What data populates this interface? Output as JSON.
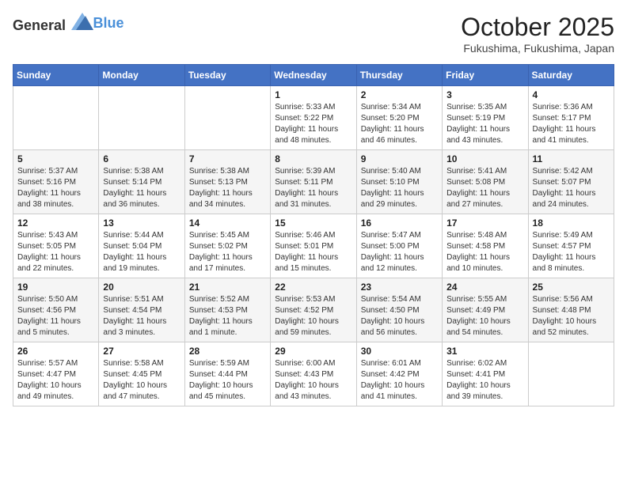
{
  "header": {
    "logo_general": "General",
    "logo_blue": "Blue",
    "month": "October 2025",
    "location": "Fukushima, Fukushima, Japan"
  },
  "days_of_week": [
    "Sunday",
    "Monday",
    "Tuesday",
    "Wednesday",
    "Thursday",
    "Friday",
    "Saturday"
  ],
  "weeks": [
    [
      {
        "day": "",
        "info": ""
      },
      {
        "day": "",
        "info": ""
      },
      {
        "day": "",
        "info": ""
      },
      {
        "day": "1",
        "info": "Sunrise: 5:33 AM\nSunset: 5:22 PM\nDaylight: 11 hours\nand 48 minutes."
      },
      {
        "day": "2",
        "info": "Sunrise: 5:34 AM\nSunset: 5:20 PM\nDaylight: 11 hours\nand 46 minutes."
      },
      {
        "day": "3",
        "info": "Sunrise: 5:35 AM\nSunset: 5:19 PM\nDaylight: 11 hours\nand 43 minutes."
      },
      {
        "day": "4",
        "info": "Sunrise: 5:36 AM\nSunset: 5:17 PM\nDaylight: 11 hours\nand 41 minutes."
      }
    ],
    [
      {
        "day": "5",
        "info": "Sunrise: 5:37 AM\nSunset: 5:16 PM\nDaylight: 11 hours\nand 38 minutes."
      },
      {
        "day": "6",
        "info": "Sunrise: 5:38 AM\nSunset: 5:14 PM\nDaylight: 11 hours\nand 36 minutes."
      },
      {
        "day": "7",
        "info": "Sunrise: 5:38 AM\nSunset: 5:13 PM\nDaylight: 11 hours\nand 34 minutes."
      },
      {
        "day": "8",
        "info": "Sunrise: 5:39 AM\nSunset: 5:11 PM\nDaylight: 11 hours\nand 31 minutes."
      },
      {
        "day": "9",
        "info": "Sunrise: 5:40 AM\nSunset: 5:10 PM\nDaylight: 11 hours\nand 29 minutes."
      },
      {
        "day": "10",
        "info": "Sunrise: 5:41 AM\nSunset: 5:08 PM\nDaylight: 11 hours\nand 27 minutes."
      },
      {
        "day": "11",
        "info": "Sunrise: 5:42 AM\nSunset: 5:07 PM\nDaylight: 11 hours\nand 24 minutes."
      }
    ],
    [
      {
        "day": "12",
        "info": "Sunrise: 5:43 AM\nSunset: 5:05 PM\nDaylight: 11 hours\nand 22 minutes."
      },
      {
        "day": "13",
        "info": "Sunrise: 5:44 AM\nSunset: 5:04 PM\nDaylight: 11 hours\nand 19 minutes."
      },
      {
        "day": "14",
        "info": "Sunrise: 5:45 AM\nSunset: 5:02 PM\nDaylight: 11 hours\nand 17 minutes."
      },
      {
        "day": "15",
        "info": "Sunrise: 5:46 AM\nSunset: 5:01 PM\nDaylight: 11 hours\nand 15 minutes."
      },
      {
        "day": "16",
        "info": "Sunrise: 5:47 AM\nSunset: 5:00 PM\nDaylight: 11 hours\nand 12 minutes."
      },
      {
        "day": "17",
        "info": "Sunrise: 5:48 AM\nSunset: 4:58 PM\nDaylight: 11 hours\nand 10 minutes."
      },
      {
        "day": "18",
        "info": "Sunrise: 5:49 AM\nSunset: 4:57 PM\nDaylight: 11 hours\nand 8 minutes."
      }
    ],
    [
      {
        "day": "19",
        "info": "Sunrise: 5:50 AM\nSunset: 4:56 PM\nDaylight: 11 hours\nand 5 minutes."
      },
      {
        "day": "20",
        "info": "Sunrise: 5:51 AM\nSunset: 4:54 PM\nDaylight: 11 hours\nand 3 minutes."
      },
      {
        "day": "21",
        "info": "Sunrise: 5:52 AM\nSunset: 4:53 PM\nDaylight: 11 hours\nand 1 minute."
      },
      {
        "day": "22",
        "info": "Sunrise: 5:53 AM\nSunset: 4:52 PM\nDaylight: 10 hours\nand 59 minutes."
      },
      {
        "day": "23",
        "info": "Sunrise: 5:54 AM\nSunset: 4:50 PM\nDaylight: 10 hours\nand 56 minutes."
      },
      {
        "day": "24",
        "info": "Sunrise: 5:55 AM\nSunset: 4:49 PM\nDaylight: 10 hours\nand 54 minutes."
      },
      {
        "day": "25",
        "info": "Sunrise: 5:56 AM\nSunset: 4:48 PM\nDaylight: 10 hours\nand 52 minutes."
      }
    ],
    [
      {
        "day": "26",
        "info": "Sunrise: 5:57 AM\nSunset: 4:47 PM\nDaylight: 10 hours\nand 49 minutes."
      },
      {
        "day": "27",
        "info": "Sunrise: 5:58 AM\nSunset: 4:45 PM\nDaylight: 10 hours\nand 47 minutes."
      },
      {
        "day": "28",
        "info": "Sunrise: 5:59 AM\nSunset: 4:44 PM\nDaylight: 10 hours\nand 45 minutes."
      },
      {
        "day": "29",
        "info": "Sunrise: 6:00 AM\nSunset: 4:43 PM\nDaylight: 10 hours\nand 43 minutes."
      },
      {
        "day": "30",
        "info": "Sunrise: 6:01 AM\nSunset: 4:42 PM\nDaylight: 10 hours\nand 41 minutes."
      },
      {
        "day": "31",
        "info": "Sunrise: 6:02 AM\nSunset: 4:41 PM\nDaylight: 10 hours\nand 39 minutes."
      },
      {
        "day": "",
        "info": ""
      }
    ]
  ]
}
